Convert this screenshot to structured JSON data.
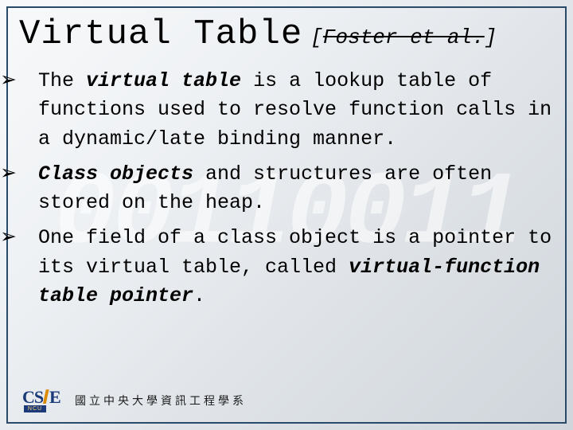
{
  "watermark": "00110011",
  "title": "Virtual Table",
  "citation": {
    "open": "[",
    "struck": "Foster et al.",
    "close": "]"
  },
  "bullets": [
    {
      "pre": "The ",
      "bold": "virtual table",
      "post": " is a lookup table of functions used to resolve function calls in a dynamic/late binding manner."
    },
    {
      "pre": "",
      "bold": "Class objects",
      "post": " and structures are often stored on the heap."
    },
    {
      "pre": "One field of a class object is a pointer to its virtual table, called ",
      "bold": "virtual-function table pointer",
      "post": "."
    }
  ],
  "logo": {
    "cs": "CS",
    "i": "I",
    "e": "E",
    "ncu": "NCU"
  },
  "footer_text": "國立中央大學資訊工程學系",
  "arrow": "➢"
}
